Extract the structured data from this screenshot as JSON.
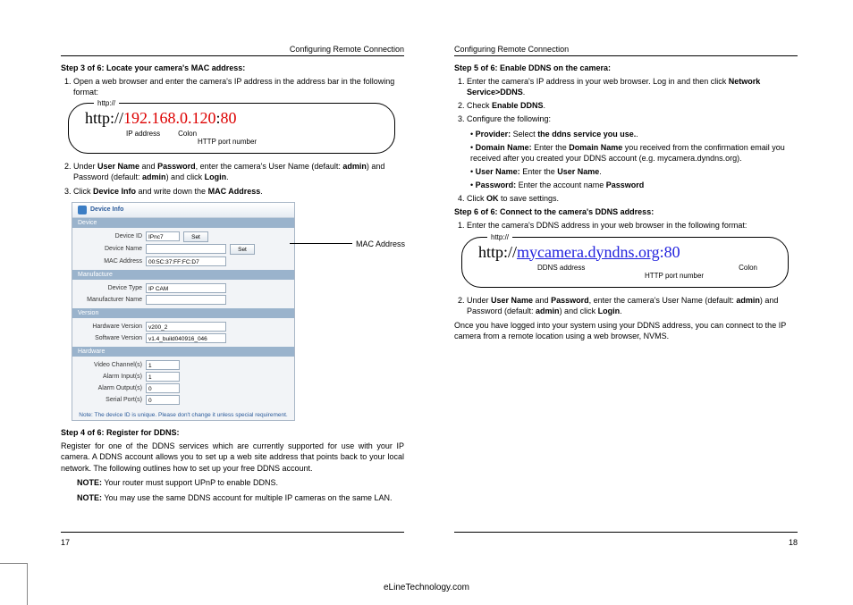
{
  "header": "Configuring Remote Connection",
  "footer_site": "eLineTechnology.com",
  "page_left_num": "17",
  "page_right_num": "18",
  "left": {
    "step3_title": "Step 3 of 6: Locate your camera's MAC address:",
    "s3_li1_a": "Open a web browser and enter the camera's IP address in the address bar in the following format:",
    "url_tag": "http://",
    "url1_prefix": "http://",
    "url1_ip": "192.168.0.120",
    "url1_colon": ":",
    "url1_port": "80",
    "url1_sub_ip": "IP address",
    "url1_sub_colon": "Colon",
    "url1_sub_port": "HTTP port number",
    "s3_li2_a": "Under ",
    "s3_li2_b": "User Name",
    "s3_li2_c": " and ",
    "s3_li2_d": "Password",
    "s3_li2_e": ", enter the camera's User Name (default: ",
    "s3_li2_f": "admin",
    "s3_li2_g": ") and Password (default: ",
    "s3_li2_h": "admin",
    "s3_li2_i": ") and click ",
    "s3_li2_j": "Login",
    "s3_li2_k": ".",
    "s3_li3_a": "Click ",
    "s3_li3_b": "Device Info",
    "s3_li3_c": " and write down the ",
    "s3_li3_d": "MAC Address",
    "s3_li3_e": ".",
    "dev_head": "Device Info",
    "dev_sect_device": "Device",
    "dev_deviceid_lbl": "Device ID",
    "dev_deviceid_val": "IPnc7",
    "dev_devicename_lbl": "Device Name",
    "dev_devicename_val": "",
    "dev_mac_lbl": "MAC Address",
    "dev_mac_val": "00:5C:37:FF:FC:D7",
    "dev_set": "Set",
    "dev_sect_manu": "Manufacture",
    "dev_type_lbl": "Device Type",
    "dev_type_val": "IP CAM",
    "dev_manu_lbl": "Manufacturer Name",
    "dev_sect_vers": "Version",
    "dev_hw_lbl": "Hardware Version",
    "dev_hw_val": "v200_2",
    "dev_sw_lbl": "Software Version",
    "dev_sw_val": "v1.4_build040916_046",
    "dev_sect_hw": "Hardware",
    "dev_vid_lbl": "Video Channel(s)",
    "dev_vid_val": "1",
    "dev_ai_lbl": "Alarm Input(s)",
    "dev_ai_val": "1",
    "dev_ao_lbl": "Alarm Output(s)",
    "dev_ao_val": "0",
    "dev_sp_lbl": "Serial Port(s)",
    "dev_sp_val": "0",
    "dev_note": "Note: The device ID is unique. Please don't change it unless special requirement.",
    "mac_callout": "MAC Address",
    "step4_title": "Step 4 of 6: Register for DDNS:",
    "s4_para": "Register for one of the DDNS services which are currently supported for use with your IP camera. A DDNS account allows you to set up a web site address that points back to your local network. The following outlines how to set up your free DDNS account.",
    "s4_note1_a": "NOTE:",
    "s4_note1_b": " Your router must support UPnP to enable DDNS.",
    "s4_note2_a": "NOTE:",
    "s4_note2_b": " You may use the same DDNS account for multiple IP cameras on the same LAN."
  },
  "right": {
    "step5_title": "Step 5 of 6: Enable DDNS on the camera:",
    "s5_li1_a": "Enter the camera's IP address in your web browser. Log in and then click ",
    "s5_li1_b": "Network Service>DDNS",
    "s5_li1_c": ".",
    "s5_li2_a": "Check ",
    "s5_li2_b": "Enable DDNS",
    "s5_li2_c": ".",
    "s5_li3": "Configure the following:",
    "s5_b1_a": "Provider:",
    "s5_b1_b": " Select ",
    "s5_b1_c": "the ddns service you use.",
    "s5_b1_d": ".",
    "s5_b2_a": "Domain Name:",
    "s5_b2_b": " Enter the ",
    "s5_b2_c": "Domain Name",
    "s5_b2_d": " you received from the confirmation email you received after you created your DDNS account (e.g. mycamera.dyndns.org).",
    "s5_b3_a": "User Name:",
    "s5_b3_b": " Enter the ",
    "s5_b3_c": "User Name",
    "s5_b3_d": ".",
    "s5_b4_a": "Password:",
    "s5_b4_b": " Enter the account name ",
    "s5_b4_c": "Password",
    "s5_li4_a": "Click ",
    "s5_li4_b": "OK",
    "s5_li4_c": " to save settings.",
    "step6_title": "Step 6 of 6: Connect to the camera's DDNS address:",
    "s6_li1": "Enter the camera's DDNS address in your web browser in the following format:",
    "url2_tag": "http://",
    "url2_prefix": "http://",
    "url2_host": "mycamera.dyndns.org",
    "url2_colon": ":",
    "url2_port": "80",
    "url2_sub_addr": "DDNS address",
    "url2_sub_colon": "Colon",
    "url2_sub_port": "HTTP port number",
    "s6_li2_a": "Under ",
    "s6_li2_b": "User Name",
    "s6_li2_c": " and ",
    "s6_li2_d": "Password",
    "s6_li2_e": ", enter the camera's User Name (default: ",
    "s6_li2_f": "admin",
    "s6_li2_g": ") and Password (default: ",
    "s6_li2_h": "admin",
    "s6_li2_i": ") and click ",
    "s6_li2_j": "Login",
    "s6_li2_k": ".",
    "s6_para": "Once you have logged into your system using your DDNS address, you can connect to the IP camera from a remote location using a web browser, NVMS."
  }
}
